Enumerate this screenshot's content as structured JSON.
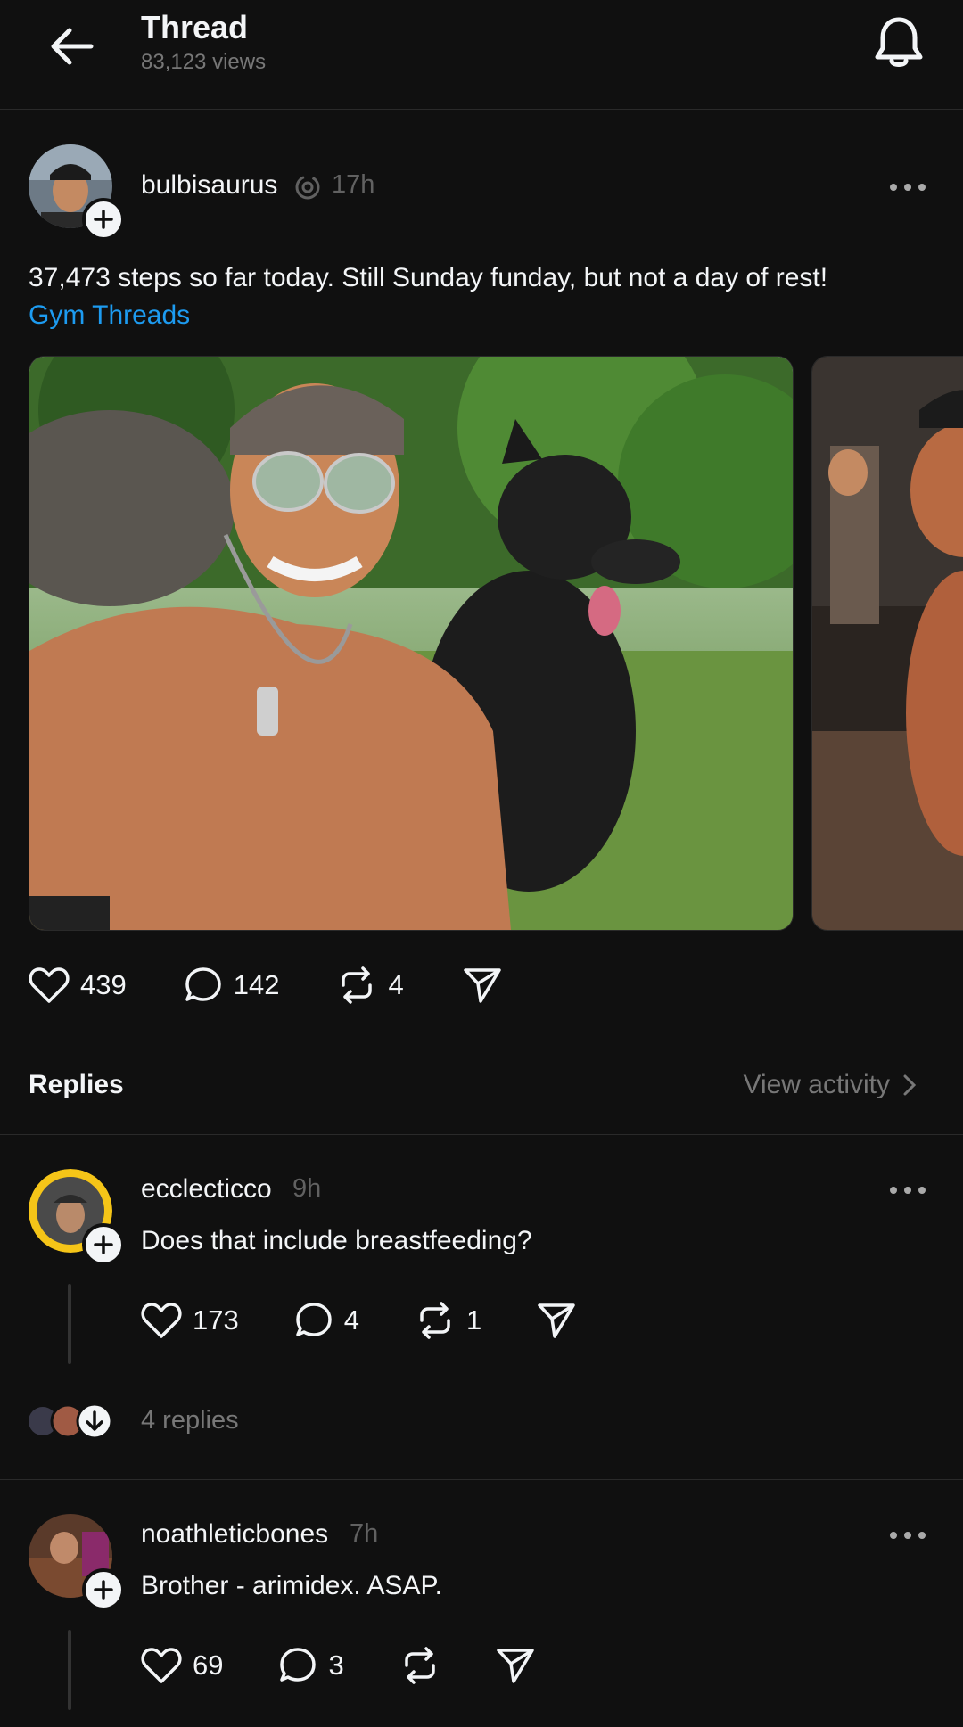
{
  "header": {
    "title": "Thread",
    "views": "83,123 views"
  },
  "post": {
    "username": "bulbisaurus",
    "time": "17h",
    "text": "37,473 steps so far today. Still Sunday funday, but not a day of rest!",
    "tag": "Gym Threads",
    "likes": "439",
    "comments": "142",
    "reposts": "4"
  },
  "replies_section": {
    "label": "Replies",
    "view_activity": "View activity"
  },
  "replies": [
    {
      "username": "ecclecticco",
      "time": "9h",
      "text": "Does that include breastfeeding?",
      "likes": "173",
      "comments": "4",
      "reposts": "1",
      "more_replies": "4 replies"
    },
    {
      "username": "noathleticbones",
      "time": "7h",
      "text": "Brother - arimidex. ASAP.",
      "likes": "69",
      "comments": "3",
      "reposts": ""
    }
  ],
  "colors": {
    "background": "#101010",
    "text": "#f3f5f7",
    "muted": "#777777",
    "link": "#1d9bf0"
  }
}
